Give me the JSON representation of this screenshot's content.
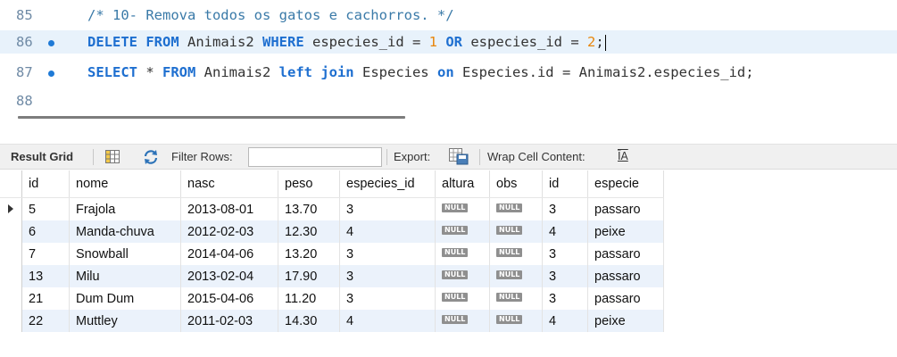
{
  "editor": {
    "lines": [
      {
        "num": "85",
        "has_dot": false,
        "segments": [
          {
            "t": "cmt",
            "v": "/* 10- Remova todos os gatos e cachorros. */"
          }
        ]
      },
      {
        "num": "86",
        "has_dot": true,
        "current": true,
        "segments": [
          {
            "t": "kw",
            "v": "DELETE"
          },
          {
            "t": "id",
            "v": " "
          },
          {
            "t": "kw",
            "v": "FROM"
          },
          {
            "t": "id",
            "v": " Animais2 "
          },
          {
            "t": "kw",
            "v": "WHERE"
          },
          {
            "t": "id",
            "v": " especies_id = "
          },
          {
            "t": "num",
            "v": "1"
          },
          {
            "t": "id",
            "v": " "
          },
          {
            "t": "kw",
            "v": "OR"
          },
          {
            "t": "id",
            "v": " especies_id = "
          },
          {
            "t": "num",
            "v": "2"
          },
          {
            "t": "id",
            "v": ";"
          }
        ]
      },
      {
        "num": "87",
        "has_dot": true,
        "segments": [
          {
            "t": "kw",
            "v": "SELECT"
          },
          {
            "t": "id",
            "v": " * "
          },
          {
            "t": "kw",
            "v": "FROM"
          },
          {
            "t": "id",
            "v": " Animais2 "
          },
          {
            "t": "kw",
            "v": "left join"
          },
          {
            "t": "id",
            "v": " Especies "
          },
          {
            "t": "kw",
            "v": "on"
          },
          {
            "t": "id",
            "v": " Especies.id = Animais2.especies_id;"
          }
        ]
      },
      {
        "num": "88",
        "has_dot": false,
        "segments": []
      }
    ]
  },
  "toolbar": {
    "result_grid_label": "Result Grid",
    "filter_rows_label": "Filter Rows:",
    "filter_value": "",
    "export_label": "Export:",
    "wrap_label": "Wrap Cell Content:",
    "icons": [
      "grid-view-icon",
      "refresh-icon",
      "export-icon",
      "wrap-text-icon"
    ]
  },
  "grid": {
    "columns": [
      "id",
      "nome",
      "nasc",
      "peso",
      "especies_id",
      "altura",
      "obs",
      "id",
      "especie"
    ],
    "rows": [
      [
        "5",
        "Frajola",
        "2013-08-01",
        "13.70",
        "3",
        "NULL",
        "NULL",
        "3",
        "passaro"
      ],
      [
        "6",
        "Manda-chuva",
        "2012-02-03",
        "12.30",
        "4",
        "NULL",
        "NULL",
        "4",
        "peixe"
      ],
      [
        "7",
        "Snowball",
        "2014-04-06",
        "13.20",
        "3",
        "NULL",
        "NULL",
        "3",
        "passaro"
      ],
      [
        "13",
        "Milu",
        "2013-02-04",
        "17.90",
        "3",
        "NULL",
        "NULL",
        "3",
        "passaro"
      ],
      [
        "21",
        "Dum Dum",
        "2015-04-06",
        "11.20",
        "3",
        "NULL",
        "NULL",
        "3",
        "passaro"
      ],
      [
        "22",
        "Muttley",
        "2011-02-03",
        "14.30",
        "4",
        "NULL",
        "NULL",
        "4",
        "peixe"
      ]
    ],
    "selected_row": 0
  },
  "colors": {
    "keyword": "#1e6fd0",
    "number": "#e8850a",
    "comment": "#3a7aa8",
    "alt_row": "#ebf2fb",
    "null_badge": "#8f8f8f"
  }
}
